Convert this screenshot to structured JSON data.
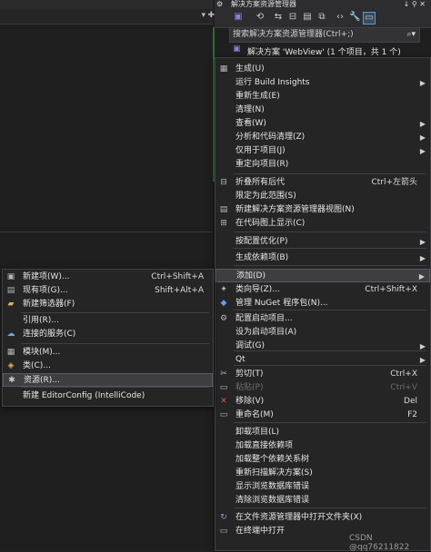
{
  "explorer": {
    "title": "解决方案资源管理器",
    "pin_glyph": "↓ ⚲ ✕",
    "search_placeholder": "搜索解决方案资源管理器(Ctrl+;)",
    "solution_label": "解决方案 'WebView' (1 个项目，共 1 个)"
  },
  "context_menu": {
    "items": [
      {
        "label": "生成(U)",
        "shortcut": "",
        "arrow": false,
        "icon": "build-icon"
      },
      {
        "label": "运行 Build Insights",
        "shortcut": "",
        "arrow": true,
        "icon": ""
      },
      {
        "label": "重新生成(E)",
        "shortcut": "",
        "arrow": false,
        "icon": ""
      },
      {
        "label": "清理(N)",
        "shortcut": "",
        "arrow": false,
        "icon": ""
      },
      {
        "label": "查看(W)",
        "shortcut": "",
        "arrow": true,
        "icon": ""
      },
      {
        "label": "分析和代码清理(Z)",
        "shortcut": "",
        "arrow": true,
        "icon": ""
      },
      {
        "label": "仅用于项目(J)",
        "shortcut": "",
        "arrow": true,
        "icon": ""
      },
      {
        "label": "重定向项目(R)",
        "shortcut": "",
        "arrow": false,
        "icon": ""
      },
      {
        "label": "折叠所有后代",
        "shortcut": "Ctrl+左箭头",
        "arrow": false,
        "icon": "collapse-icon"
      },
      {
        "label": "限定为此范围(S)",
        "shortcut": "",
        "arrow": false,
        "icon": ""
      },
      {
        "label": "新建解决方案资源管理器视图(N)",
        "shortcut": "",
        "arrow": false,
        "icon": "new-view-icon"
      },
      {
        "label": "在代码图上显示(C)",
        "shortcut": "",
        "arrow": false,
        "icon": "code-map-icon"
      },
      {
        "label": "按配置优化(P)",
        "shortcut": "",
        "arrow": true,
        "icon": ""
      },
      {
        "label": "生成依赖项(B)",
        "shortcut": "",
        "arrow": true,
        "icon": ""
      },
      {
        "label": "添加(D)",
        "shortcut": "",
        "arrow": true,
        "icon": ""
      },
      {
        "label": "类向导(Z)...",
        "shortcut": "Ctrl+Shift+X",
        "arrow": false,
        "icon": "class-wizard-icon"
      },
      {
        "label": "管理 NuGet 程序包(N)...",
        "shortcut": "",
        "arrow": false,
        "icon": "nuget-icon"
      },
      {
        "label": "配置启动项目...",
        "shortcut": "",
        "arrow": false,
        "icon": "gear-icon"
      },
      {
        "label": "设为启动项目(A)",
        "shortcut": "",
        "arrow": false,
        "icon": ""
      },
      {
        "label": "调试(G)",
        "shortcut": "",
        "arrow": true,
        "icon": ""
      },
      {
        "label": "Qt",
        "shortcut": "",
        "arrow": true,
        "icon": ""
      },
      {
        "label": "剪切(T)",
        "shortcut": "Ctrl+X",
        "arrow": false,
        "icon": "scissors-icon"
      },
      {
        "label": "粘贴(P)",
        "shortcut": "Ctrl+V",
        "arrow": false,
        "icon": "paste-icon"
      },
      {
        "label": "移除(V)",
        "shortcut": "Del",
        "arrow": false,
        "icon": "remove-icon"
      },
      {
        "label": "重命名(M)",
        "shortcut": "F2",
        "arrow": false,
        "icon": "rename-icon"
      },
      {
        "label": "卸载项目(L)",
        "shortcut": "",
        "arrow": false,
        "icon": ""
      },
      {
        "label": "加载直接依赖项",
        "shortcut": "",
        "arrow": false,
        "icon": ""
      },
      {
        "label": "加载整个依赖关系树",
        "shortcut": "",
        "arrow": false,
        "icon": ""
      },
      {
        "label": "重新扫描解决方案(S)",
        "shortcut": "",
        "arrow": false,
        "icon": ""
      },
      {
        "label": "显示浏览数据库错误",
        "shortcut": "",
        "arrow": false,
        "icon": ""
      },
      {
        "label": "清除浏览数据库错误",
        "shortcut": "",
        "arrow": false,
        "icon": ""
      },
      {
        "label": "在文件资源管理器中打开文件夹(X)",
        "shortcut": "",
        "arrow": false,
        "icon": "open-folder-icon"
      },
      {
        "label": "在终端中打开",
        "shortcut": "",
        "arrow": false,
        "icon": "terminal-icon"
      }
    ]
  },
  "add_submenu": {
    "items": [
      {
        "label": "新建项(W)...",
        "shortcut": "Ctrl+Shift+A",
        "icon": "new-item-icon"
      },
      {
        "label": "现有项(G)...",
        "shortcut": "Shift+Alt+A",
        "icon": "existing-item-icon"
      },
      {
        "label": "新建筛选器(F)",
        "shortcut": "",
        "icon": "filter-folder-icon"
      },
      {
        "label": "引用(R)...",
        "shortcut": "",
        "icon": ""
      },
      {
        "label": "连接的服务(C)",
        "shortcut": "",
        "icon": "connected-service-icon"
      },
      {
        "label": "模块(M)...",
        "shortcut": "",
        "icon": "module-icon"
      },
      {
        "label": "类(C)...",
        "shortcut": "",
        "icon": "class-icon"
      },
      {
        "label": "资源(R)...",
        "shortcut": "",
        "icon": "resource-icon"
      },
      {
        "label": "新建 EditorConfig (IntelliCode)",
        "shortcut": "",
        "icon": ""
      }
    ]
  },
  "watermark": "CSDN @qq76211822"
}
